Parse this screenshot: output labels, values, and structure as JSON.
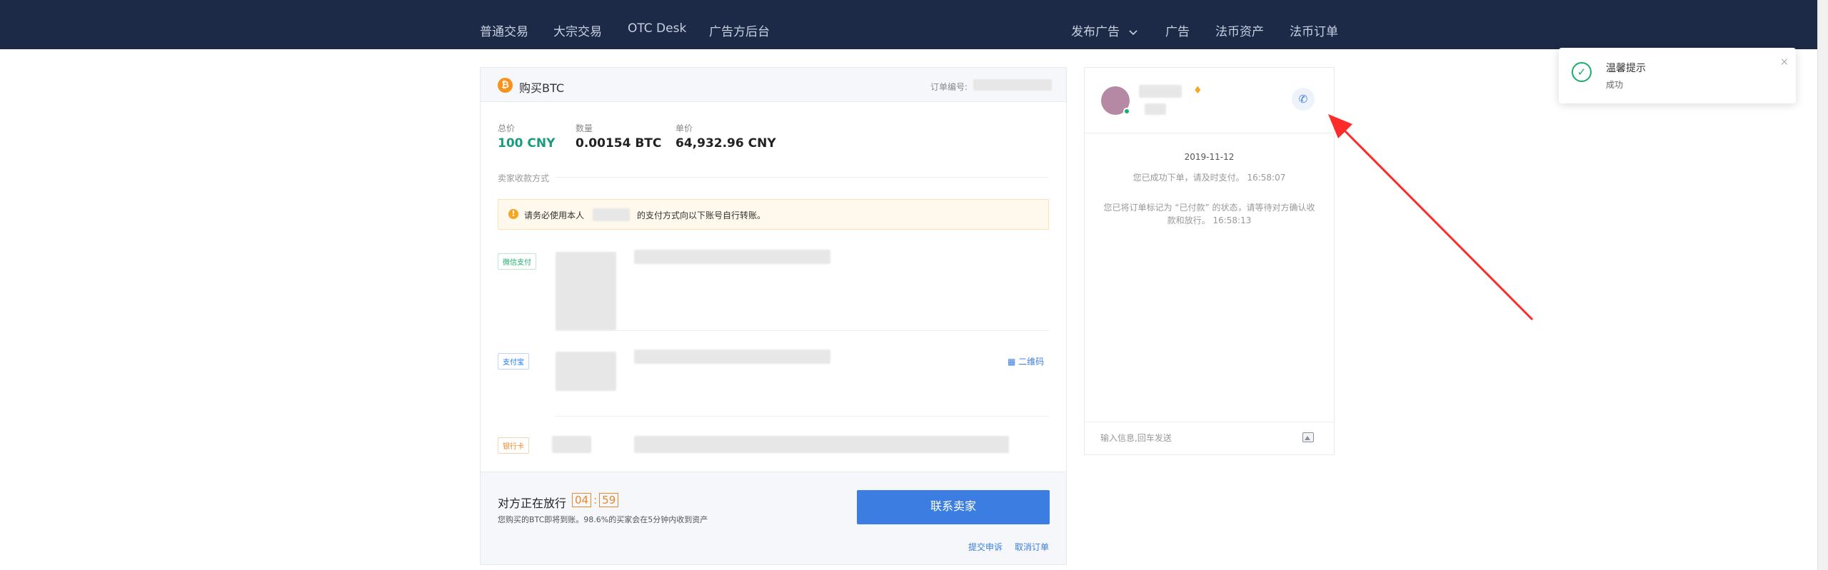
{
  "nav": {
    "left_items": [
      "普通交易",
      "大宗交易",
      "OTC Desk",
      "广告方后台"
    ],
    "right_items": [
      {
        "label": "发布广告",
        "has_dropdown": true
      },
      {
        "label": "广告",
        "has_dropdown": false
      },
      {
        "label": "法币资产",
        "has_dropdown": false
      },
      {
        "label": "法币订单",
        "has_dropdown": false
      }
    ]
  },
  "order": {
    "coin_icon": "₿",
    "title": "购买BTC",
    "order_no_label": "订单编号:",
    "stats": [
      {
        "label": "总价",
        "value": "100 CNY",
        "highlight": true
      },
      {
        "label": "数量",
        "value": "0.00154 BTC",
        "highlight": false
      },
      {
        "label": "单价",
        "value": "64,932.96 CNY",
        "highlight": false
      }
    ],
    "payment_section_label": "卖家收款方式",
    "warning": {
      "icon": "!",
      "before_name": "请务必使用本人",
      "after_name": "的支付方式向以下账号自行转账。"
    },
    "payment_methods": [
      {
        "tag": "微信支付",
        "kind": "wechat"
      },
      {
        "tag": "支付宝",
        "kind": "alipay"
      },
      {
        "tag": "银行卡",
        "kind": "bank"
      }
    ],
    "qr_link": "二维码",
    "qr_icon": "▦",
    "footer": {
      "release_title": "对方正在放行",
      "timer_minutes": "04",
      "timer_seconds": "59",
      "timer_sep": ":",
      "release_sub": "您购买的BTC即将到账。98.6%的买家会在5分钟内收到资产",
      "contact_button": "联系卖家",
      "appeal_link": "提交申诉",
      "cancel_link": "取消订单"
    }
  },
  "chat": {
    "badge_icon": "♦",
    "phone_icon": "✆",
    "date": "2019-11-12",
    "messages": [
      "您已成功下单，请及时支付。 16:58:07",
      "您已将订单标记为 “已付款” 的状态，请等待对方确认收款和放行。 16:58:13"
    ],
    "input_placeholder": "输入信息,回车发送"
  },
  "toast": {
    "icon": "✓",
    "title": "温馨提示",
    "message": "成功",
    "close": "×"
  },
  "colors": {
    "nav_bg": "#1c2a48",
    "accent_blue": "#3b7de0",
    "price_green": "#1a9b7e",
    "timer_orange": "#e8892a",
    "annotation_red": "#ff2a2a"
  }
}
